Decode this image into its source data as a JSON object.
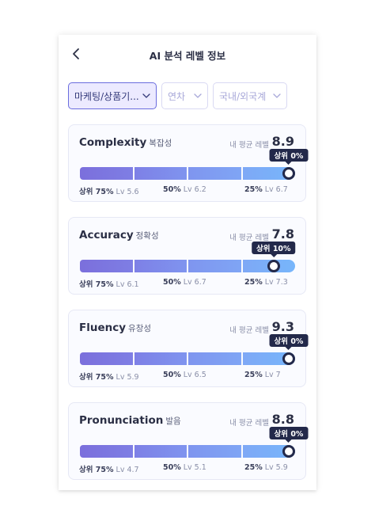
{
  "header": {
    "title": "AI 분석 레벨 정보"
  },
  "filters": [
    {
      "label": "마케팅/상품기...",
      "active": true
    },
    {
      "label": "연차",
      "active": false
    },
    {
      "label": "국내/외국계",
      "active": false
    }
  ],
  "avg_label": "내 평균 레벨",
  "cards": [
    {
      "name": "Complexity",
      "sub": "복잡성",
      "avg": "8.9",
      "rank": "상위 0%",
      "marker_pct": 100,
      "scale": [
        {
          "pct": "상위 75%",
          "lv": "Lv 5.6"
        },
        {
          "pct": "50%",
          "lv": "Lv 6.2"
        },
        {
          "pct": "25%",
          "lv": "Lv 6.7"
        }
      ]
    },
    {
      "name": "Accuracy",
      "sub": "정확성",
      "avg": "7.8",
      "rank": "상위 10%",
      "marker_pct": 90,
      "scale": [
        {
          "pct": "상위 75%",
          "lv": "Lv 6.1"
        },
        {
          "pct": "50%",
          "lv": "Lv 6.7"
        },
        {
          "pct": "25%",
          "lv": "Lv 7.3"
        }
      ]
    },
    {
      "name": "Fluency",
      "sub": "유창성",
      "avg": "9.3",
      "rank": "상위 0%",
      "marker_pct": 100,
      "scale": [
        {
          "pct": "상위 75%",
          "lv": "Lv 5.9"
        },
        {
          "pct": "50%",
          "lv": "Lv 6.5"
        },
        {
          "pct": "25%",
          "lv": "Lv 7"
        }
      ]
    },
    {
      "name": "Pronunciation",
      "sub": "발음",
      "avg": "8.8",
      "rank": "상위 0%",
      "marker_pct": 100,
      "scale": [
        {
          "pct": "상위 75%",
          "lv": "Lv 4.7"
        },
        {
          "pct": "50%",
          "lv": "Lv 5.1"
        },
        {
          "pct": "25%",
          "lv": "Lv 5.9"
        }
      ]
    }
  ],
  "colors": {
    "accent": "#6a6cde",
    "dark": "#23294a",
    "bar_start": "#7b6fdc",
    "bar_end": "#77b6fb"
  },
  "icons": {
    "back": "chevron-left-icon",
    "dropdown": "chevron-down-icon"
  }
}
